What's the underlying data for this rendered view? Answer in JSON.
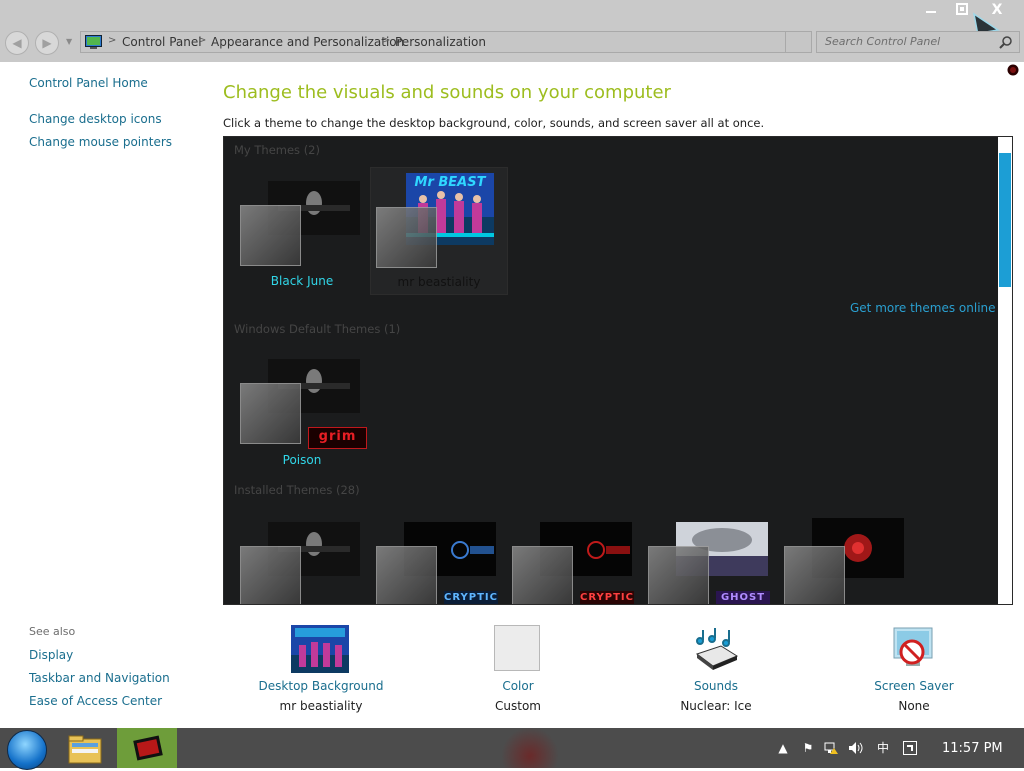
{
  "window": {
    "minimize_icon": "minimize-icon",
    "restore_icon": "restore-icon",
    "close_label": "X"
  },
  "address": {
    "breadcrumbs": [
      "Control Panel",
      "Appearance and Personalization",
      "Personalization"
    ],
    "search_placeholder": "Search Control Panel"
  },
  "sidebar": {
    "home": "Control Panel Home",
    "links": [
      "Change desktop icons",
      "Change mouse pointers"
    ],
    "see_also_title": "See also",
    "see_also": [
      "Display",
      "Taskbar and Navigation",
      "Ease of Access Center"
    ]
  },
  "main": {
    "title": "Change the visuals and sounds on your computer",
    "subtitle": "Click a theme to change the desktop background, color, sounds, and screen saver all at once."
  },
  "themes": {
    "my_themes_label": "My Themes (2)",
    "my_themes": [
      {
        "name": "Black June"
      },
      {
        "name": "mr beastiality",
        "banner": "Mr BEAST"
      }
    ],
    "more_online": "Get more themes online",
    "default_label": "Windows Default Themes (1)",
    "default_themes": [
      {
        "name": "Poison",
        "badge": "grim"
      }
    ],
    "installed_label": "Installed Themes (28)",
    "installed_badges": [
      "CRYPTIC",
      "CRYPTIC",
      "GHOST"
    ]
  },
  "bottom": {
    "items": [
      {
        "label": "Desktop Background",
        "value": "mr beastiality"
      },
      {
        "label": "Color",
        "value": "Custom"
      },
      {
        "label": "Sounds",
        "value": "Nuclear: Ice"
      },
      {
        "label": "Screen Saver",
        "value": "None"
      }
    ]
  },
  "taskbar": {
    "clock": "11:57 PM",
    "ime": "中"
  },
  "colors": {
    "title_accent": "#9dbd1f",
    "link": "#1a6e8e",
    "theme_name": "#31d6e8",
    "panel_bg": "#1b1c1d",
    "scroll_thumb": "#1c9ed5"
  }
}
